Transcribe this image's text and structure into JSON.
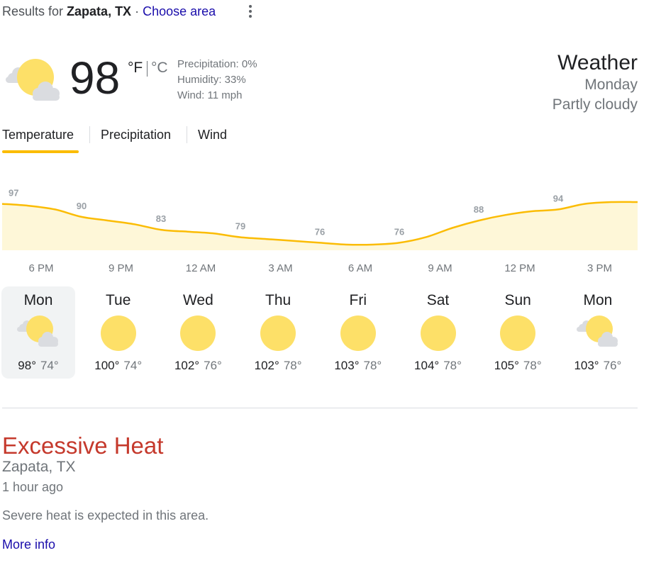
{
  "header": {
    "results_prefix": "Results for",
    "location": "Zapata, TX",
    "separator": "·",
    "choose_area": "Choose area"
  },
  "current": {
    "temperature": "98",
    "unit_f": "°F",
    "unit_c": "°C",
    "precipitation": "Precipitation: 0%",
    "humidity": "Humidity: 33%",
    "wind": "Wind: 11 mph",
    "icon": "partly-cloudy-icon"
  },
  "summary": {
    "title": "Weather",
    "day": "Monday",
    "condition": "Partly cloudy"
  },
  "tabs": [
    "Temperature",
    "Precipitation",
    "Wind"
  ],
  "colors": {
    "accent": "#fbbc04",
    "sun": "#fde068",
    "chart_fill": "#fef7d8",
    "alert": "#c5392c",
    "link": "#1a0dab"
  },
  "chart_data": {
    "type": "area",
    "x": [
      "6 PM",
      "9 PM",
      "12 AM",
      "3 AM",
      "6 AM",
      "9 AM",
      "12 PM",
      "3 PM"
    ],
    "values": [
      97,
      90,
      83,
      79,
      76,
      76,
      88,
      94
    ],
    "data_labels": [
      "97",
      "90",
      "83",
      "79",
      "76",
      "76",
      "88",
      "94"
    ],
    "curve": [
      {
        "hour": 0,
        "temp": 97
      },
      {
        "hour": 1,
        "temp": 96
      },
      {
        "hour": 2,
        "temp": 94
      },
      {
        "hour": 3,
        "temp": 90
      },
      {
        "hour": 4,
        "temp": 88
      },
      {
        "hour": 5,
        "temp": 86
      },
      {
        "hour": 6,
        "temp": 83
      },
      {
        "hour": 7,
        "temp": 82
      },
      {
        "hour": 8,
        "temp": 81
      },
      {
        "hour": 9,
        "temp": 79
      },
      {
        "hour": 10,
        "temp": 78
      },
      {
        "hour": 11,
        "temp": 77
      },
      {
        "hour": 12,
        "temp": 76
      },
      {
        "hour": 13,
        "temp": 75
      },
      {
        "hour": 14,
        "temp": 75
      },
      {
        "hour": 15,
        "temp": 76
      },
      {
        "hour": 16,
        "temp": 79
      },
      {
        "hour": 17,
        "temp": 84
      },
      {
        "hour": 18,
        "temp": 88
      },
      {
        "hour": 19,
        "temp": 91
      },
      {
        "hour": 20,
        "temp": 93
      },
      {
        "hour": 21,
        "temp": 94
      },
      {
        "hour": 22,
        "temp": 97
      },
      {
        "hour": 23,
        "temp": 98
      },
      {
        "hour": 24,
        "temp": 98
      }
    ]
  },
  "forecast": [
    {
      "day": "Mon",
      "icon": "partly-cloudy-icon",
      "high": "98°",
      "low": "74°"
    },
    {
      "day": "Tue",
      "icon": "sunny-icon",
      "high": "100°",
      "low": "74°"
    },
    {
      "day": "Wed",
      "icon": "sunny-icon",
      "high": "102°",
      "low": "76°"
    },
    {
      "day": "Thu",
      "icon": "sunny-icon",
      "high": "102°",
      "low": "78°"
    },
    {
      "day": "Fri",
      "icon": "sunny-icon",
      "high": "103°",
      "low": "78°"
    },
    {
      "day": "Sat",
      "icon": "sunny-icon",
      "high": "104°",
      "low": "78°"
    },
    {
      "day": "Sun",
      "icon": "sunny-icon",
      "high": "105°",
      "low": "78°"
    },
    {
      "day": "Mon",
      "icon": "partly-cloudy-icon",
      "high": "103°",
      "low": "76°"
    }
  ],
  "alert": {
    "title": "Excessive Heat",
    "location": "Zapata, TX",
    "time": "1 hour ago",
    "description": "Severe heat is expected in this area.",
    "more_info": "More info"
  }
}
